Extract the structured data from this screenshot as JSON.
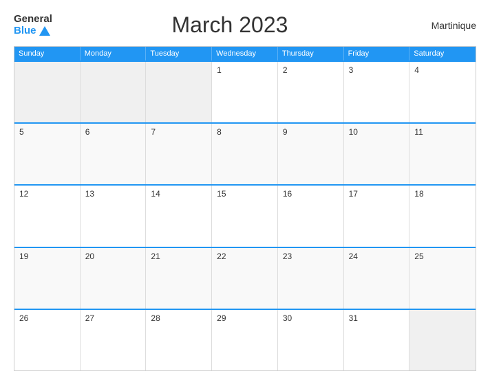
{
  "header": {
    "logo_general": "General",
    "logo_blue": "Blue",
    "title": "March 2023",
    "location": "Martinique"
  },
  "days_of_week": [
    "Sunday",
    "Monday",
    "Tuesday",
    "Wednesday",
    "Thursday",
    "Friday",
    "Saturday"
  ],
  "weeks": [
    [
      {
        "day": "",
        "empty": true
      },
      {
        "day": "",
        "empty": true
      },
      {
        "day": "",
        "empty": true
      },
      {
        "day": "1",
        "empty": false
      },
      {
        "day": "2",
        "empty": false
      },
      {
        "day": "3",
        "empty": false
      },
      {
        "day": "4",
        "empty": false
      }
    ],
    [
      {
        "day": "5",
        "empty": false
      },
      {
        "day": "6",
        "empty": false
      },
      {
        "day": "7",
        "empty": false
      },
      {
        "day": "8",
        "empty": false
      },
      {
        "day": "9",
        "empty": false
      },
      {
        "day": "10",
        "empty": false
      },
      {
        "day": "11",
        "empty": false
      }
    ],
    [
      {
        "day": "12",
        "empty": false
      },
      {
        "day": "13",
        "empty": false
      },
      {
        "day": "14",
        "empty": false
      },
      {
        "day": "15",
        "empty": false
      },
      {
        "day": "16",
        "empty": false
      },
      {
        "day": "17",
        "empty": false
      },
      {
        "day": "18",
        "empty": false
      }
    ],
    [
      {
        "day": "19",
        "empty": false
      },
      {
        "day": "20",
        "empty": false
      },
      {
        "day": "21",
        "empty": false
      },
      {
        "day": "22",
        "empty": false
      },
      {
        "day": "23",
        "empty": false
      },
      {
        "day": "24",
        "empty": false
      },
      {
        "day": "25",
        "empty": false
      }
    ],
    [
      {
        "day": "26",
        "empty": false
      },
      {
        "day": "27",
        "empty": false
      },
      {
        "day": "28",
        "empty": false
      },
      {
        "day": "29",
        "empty": false
      },
      {
        "day": "30",
        "empty": false
      },
      {
        "day": "31",
        "empty": false
      },
      {
        "day": "",
        "empty": true
      }
    ]
  ]
}
